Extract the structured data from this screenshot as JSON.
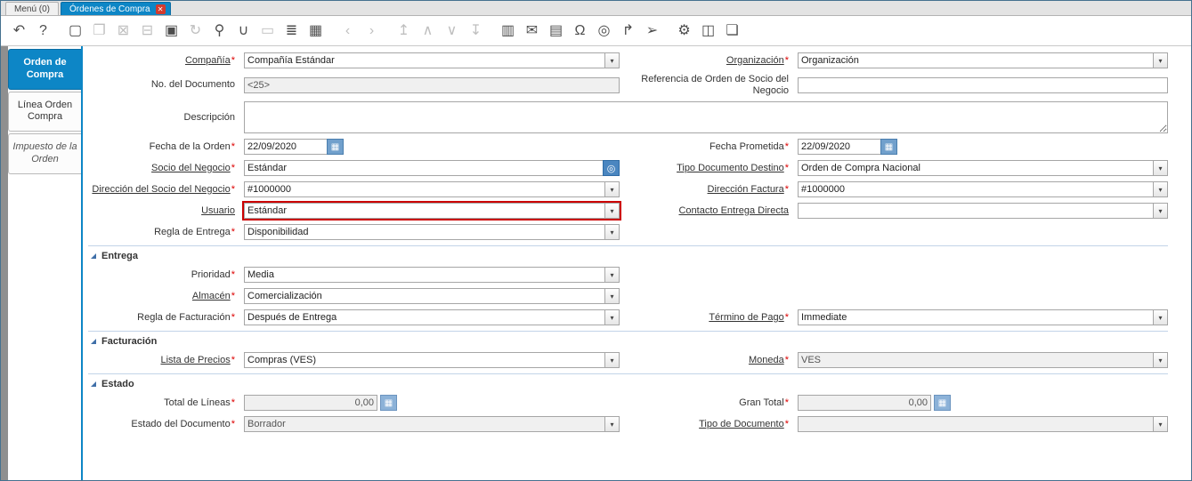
{
  "window_tabs": {
    "menu": {
      "label": "Menú (0)"
    },
    "active": {
      "label": "Órdenes de Compra"
    }
  },
  "glyphs": {
    "dropdown": "▾",
    "calendar": "▦",
    "calc": "▦",
    "bp_search": "◎",
    "close": "✕"
  },
  "toolbar": {
    "icons": [
      {
        "name": "undo",
        "glyph": "↶",
        "disabled": false
      },
      {
        "name": "help",
        "glyph": "?",
        "disabled": false
      },
      {
        "name": "new-record",
        "glyph": "▢",
        "disabled": false,
        "gap": true
      },
      {
        "name": "copy-record",
        "glyph": "❐",
        "disabled": true
      },
      {
        "name": "delete-record",
        "glyph": "⊠",
        "disabled": true
      },
      {
        "name": "delete-selection",
        "glyph": "⊟",
        "disabled": true
      },
      {
        "name": "save",
        "glyph": "▣",
        "disabled": false
      },
      {
        "name": "refresh",
        "glyph": "↻",
        "disabled": true
      },
      {
        "name": "find",
        "glyph": "⚲",
        "disabled": false
      },
      {
        "name": "attachment",
        "glyph": "∪",
        "disabled": false
      },
      {
        "name": "chat",
        "glyph": "▭",
        "disabled": true
      },
      {
        "name": "record-info",
        "glyph": "≣",
        "disabled": false
      },
      {
        "name": "calendar",
        "glyph": "▦",
        "disabled": false
      },
      {
        "name": "previous-record",
        "glyph": "‹",
        "disabled": true,
        "gap": true
      },
      {
        "name": "next-record",
        "glyph": "›",
        "disabled": true
      },
      {
        "name": "first-record",
        "glyph": "↥",
        "disabled": true,
        "gap": true
      },
      {
        "name": "parent-record",
        "glyph": "∧",
        "disabled": true
      },
      {
        "name": "detail-record",
        "glyph": "∨",
        "disabled": true
      },
      {
        "name": "last-record",
        "glyph": "↧",
        "disabled": true
      },
      {
        "name": "report",
        "glyph": "▥",
        "disabled": false,
        "gap": true
      },
      {
        "name": "archive",
        "glyph": "✉",
        "disabled": false
      },
      {
        "name": "print",
        "glyph": "▤",
        "disabled": false
      },
      {
        "name": "lock",
        "glyph": "Ω",
        "disabled": false
      },
      {
        "name": "zoom-across",
        "glyph": "◎",
        "disabled": false
      },
      {
        "name": "workflow",
        "glyph": "↱",
        "disabled": false
      },
      {
        "name": "send-mail",
        "glyph": "➢",
        "disabled": false
      },
      {
        "name": "preference",
        "glyph": "⚙",
        "disabled": false,
        "gap": true
      },
      {
        "name": "product-info",
        "glyph": "◫",
        "disabled": false
      },
      {
        "name": "window-customization",
        "glyph": "❏",
        "disabled": false
      }
    ]
  },
  "sidebar": {
    "tabs": [
      {
        "label": "Orden de Compra"
      },
      {
        "label": "Línea Orden Compra"
      },
      {
        "label": "Impuesto de la Orden"
      }
    ]
  },
  "form": {
    "required_marker": "*",
    "sections": {
      "entrega": "Entrega",
      "facturacion": "Facturación",
      "estado": "Estado"
    },
    "compania": {
      "label": "Compañía",
      "value": "Compañía Estándar"
    },
    "organizacion": {
      "label": "Organización",
      "value": "Organización"
    },
    "no_documento": {
      "label": "No. del Documento",
      "value": "<25>"
    },
    "referencia": {
      "label": "Referencia de Orden de Socio del Negocio",
      "value": ""
    },
    "descripcion": {
      "label": "Descripción",
      "value": ""
    },
    "fecha_orden": {
      "label": "Fecha de la Orden",
      "value": "22/09/2020"
    },
    "fecha_prometida": {
      "label": "Fecha Prometida",
      "value": "22/09/2020"
    },
    "socio": {
      "label": "Socio del Negocio",
      "value": "Estándar"
    },
    "tipo_doc_destino": {
      "label": "Tipo Documento Destino",
      "value": "Orden de Compra Nacional"
    },
    "direccion_socio": {
      "label": "Dirección del Socio del Negocio",
      "value": "#1000000"
    },
    "direccion_factura": {
      "label": "Dirección Factura",
      "value": "#1000000"
    },
    "usuario": {
      "label": "Usuario",
      "value": "Estándar"
    },
    "contacto": {
      "label": "Contacto Entrega Directa",
      "value": ""
    },
    "regla_entrega": {
      "label": "Regla de Entrega",
      "value": "Disponibilidad"
    },
    "prioridad": {
      "label": "Prioridad",
      "value": "Media"
    },
    "almacen": {
      "label": "Almacén",
      "value": "Comercialización"
    },
    "regla_facturacion": {
      "label": "Regla de Facturación",
      "value": "Después de Entrega"
    },
    "termino_pago": {
      "label": "Término de Pago",
      "value": "Immediate"
    },
    "lista_precios": {
      "label": "Lista de Precios",
      "value": "Compras (VES)"
    },
    "moneda": {
      "label": "Moneda",
      "value": "VES"
    },
    "total_lineas": {
      "label": "Total de Líneas",
      "value": "0,00"
    },
    "gran_total": {
      "label": "Gran Total",
      "value": "0,00"
    },
    "estado_documento": {
      "label": "Estado del Documento",
      "value": "Borrador"
    },
    "tipo_documento": {
      "label": "Tipo de Documento",
      "value": ""
    }
  }
}
